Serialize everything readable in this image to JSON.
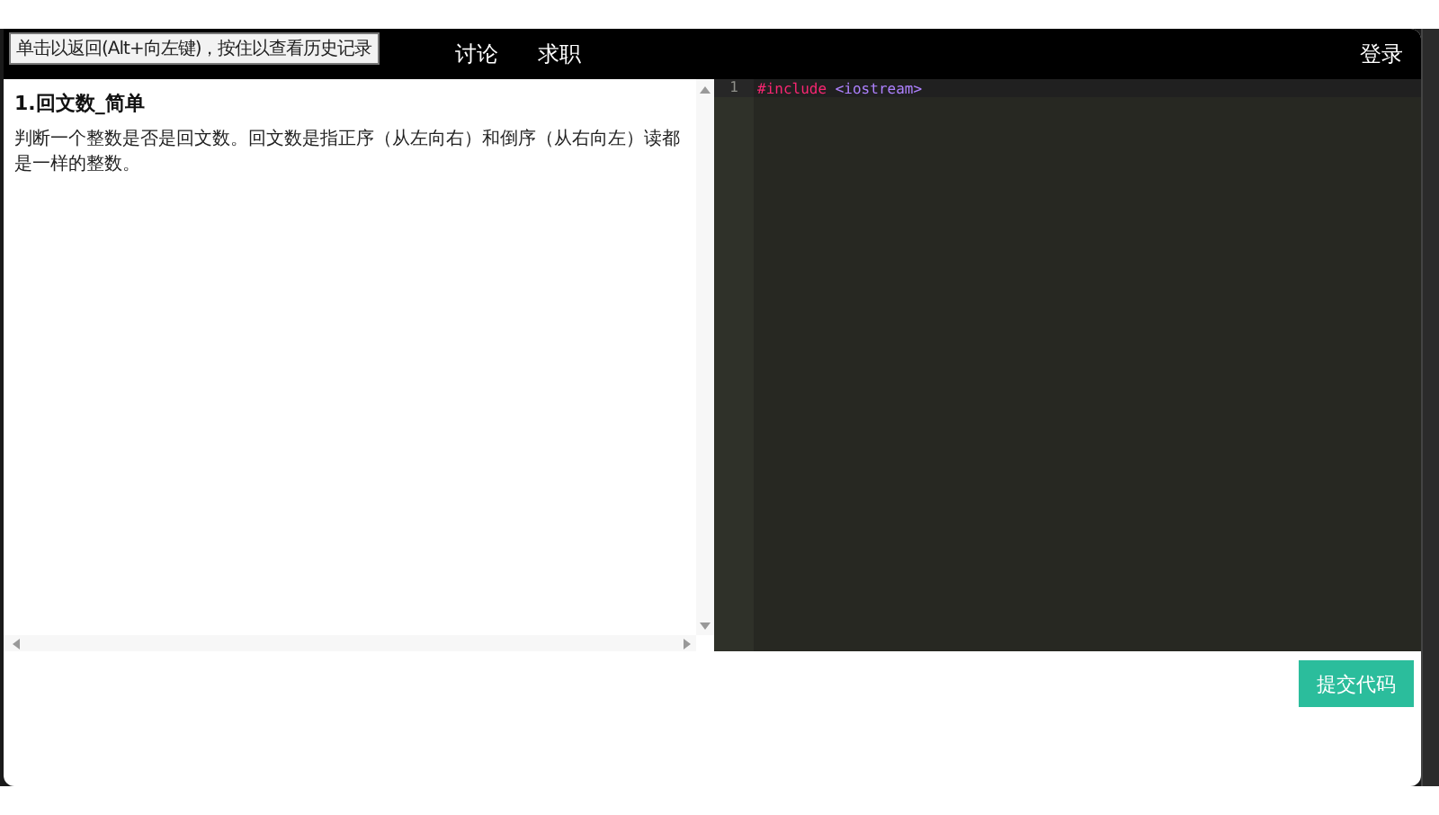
{
  "tooltip": "单击以返回(Alt+向左键)，按住以查看历史记录",
  "nav": {
    "items": [
      {
        "label": "讨论"
      },
      {
        "label": "求职"
      }
    ],
    "login": "登录"
  },
  "problem": {
    "title": "1.回文数_简单",
    "description": "判断一个整数是否是回文数。回文数是指正序（从左向右）和倒序（从右向左）读都是一样的整数。"
  },
  "editor": {
    "lines": [
      {
        "number": "1",
        "keyword": "#include",
        "header": "<iostream>"
      }
    ]
  },
  "submit": "提交代码"
}
